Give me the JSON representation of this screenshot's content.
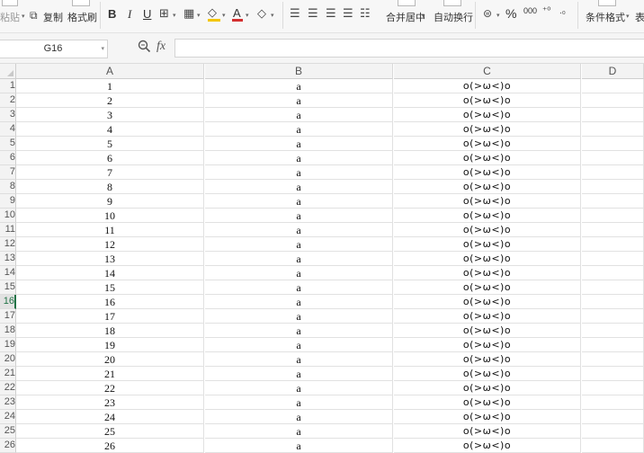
{
  "ribbon": {
    "paste": "粘贴",
    "copy": "复制",
    "format_painter": "格式刷",
    "bold": "B",
    "italic": "I",
    "underline": "U",
    "font_color_glyph": "A",
    "merge_center": "合并居中",
    "wrap_text": "自动换行",
    "percent": "%",
    "thousands": "000",
    "conditional_format": "条件格式",
    "table_style": "表",
    "top_partial": "• • • • •",
    "accent_color": "#217346",
    "font_color": "#d32f2f",
    "fill_color": "#f3c600"
  },
  "formula_bar": {
    "name_box": "G16",
    "fx_label": "fx",
    "formula_value": ""
  },
  "sheet": {
    "columns": [
      "A",
      "B",
      "C",
      "D"
    ],
    "selected_row": 16,
    "rows": [
      {
        "row": "1",
        "a": "1",
        "b": "a",
        "c": "o(>ω<)o"
      },
      {
        "row": "2",
        "a": "2",
        "b": "a",
        "c": "o(>ω<)o"
      },
      {
        "row": "3",
        "a": "3",
        "b": "a",
        "c": "o(>ω<)o"
      },
      {
        "row": "4",
        "a": "4",
        "b": "a",
        "c": "o(>ω<)o"
      },
      {
        "row": "5",
        "a": "5",
        "b": "a",
        "c": "o(>ω<)o"
      },
      {
        "row": "6",
        "a": "6",
        "b": "a",
        "c": "o(>ω<)o"
      },
      {
        "row": "7",
        "a": "7",
        "b": "a",
        "c": "o(>ω<)o"
      },
      {
        "row": "8",
        "a": "8",
        "b": "a",
        "c": "o(>ω<)o"
      },
      {
        "row": "9",
        "a": "9",
        "b": "a",
        "c": "o(>ω<)o"
      },
      {
        "row": "10",
        "a": "10",
        "b": "a",
        "c": "o(>ω<)o"
      },
      {
        "row": "11",
        "a": "11",
        "b": "a",
        "c": "o(>ω<)o"
      },
      {
        "row": "12",
        "a": "12",
        "b": "a",
        "c": "o(>ω<)o"
      },
      {
        "row": "13",
        "a": "13",
        "b": "a",
        "c": "o(>ω<)o"
      },
      {
        "row": "14",
        "a": "14",
        "b": "a",
        "c": "o(>ω<)o"
      },
      {
        "row": "15",
        "a": "15",
        "b": "a",
        "c": "o(>ω<)o"
      },
      {
        "row": "16",
        "a": "16",
        "b": "a",
        "c": "o(>ω<)o"
      },
      {
        "row": "17",
        "a": "17",
        "b": "a",
        "c": "o(>ω<)o"
      },
      {
        "row": "18",
        "a": "18",
        "b": "a",
        "c": "o(>ω<)o"
      },
      {
        "row": "19",
        "a": "19",
        "b": "a",
        "c": "o(>ω<)o"
      },
      {
        "row": "20",
        "a": "20",
        "b": "a",
        "c": "o(>ω<)o"
      },
      {
        "row": "21",
        "a": "21",
        "b": "a",
        "c": "o(>ω<)o"
      },
      {
        "row": "22",
        "a": "22",
        "b": "a",
        "c": "o(>ω<)o"
      },
      {
        "row": "23",
        "a": "23",
        "b": "a",
        "c": "o(>ω<)o"
      },
      {
        "row": "24",
        "a": "24",
        "b": "a",
        "c": "o(>ω<)o"
      },
      {
        "row": "25",
        "a": "25",
        "b": "a",
        "c": "o(>ω<)o"
      },
      {
        "row": "26",
        "a": "26",
        "b": "a",
        "c": "o(>ω<)o"
      }
    ]
  }
}
